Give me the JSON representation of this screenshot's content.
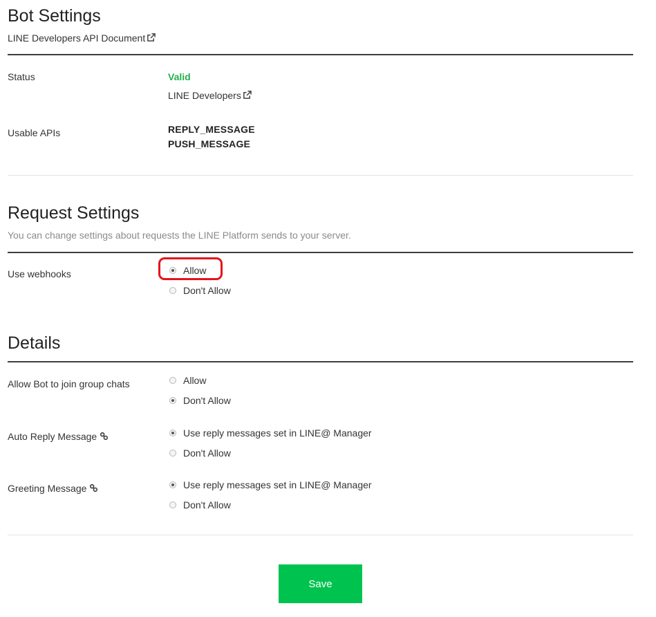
{
  "bot_settings": {
    "title": "Bot Settings",
    "doc_link": "LINE Developers API Document",
    "status_label": "Status",
    "status_value": "Valid",
    "status_link": "LINE Developers",
    "usable_apis_label": "Usable APIs",
    "usable_apis": [
      "REPLY_MESSAGE",
      "PUSH_MESSAGE"
    ]
  },
  "request_settings": {
    "title": "Request Settings",
    "description": "You can change settings about requests the LINE Platform sends to your server.",
    "webhooks_label": "Use webhooks",
    "webhooks_options": [
      "Allow",
      "Don't Allow"
    ],
    "webhooks_selected": "Allow"
  },
  "details": {
    "title": "Details",
    "group_chats_label": "Allow Bot to join group chats",
    "group_chats_options": [
      "Allow",
      "Don't Allow"
    ],
    "group_chats_selected": "Don't Allow",
    "auto_reply_label": "Auto Reply Message",
    "auto_reply_options": [
      "Use reply messages set in LINE@ Manager",
      "Don't Allow"
    ],
    "auto_reply_selected": "Use reply messages set in LINE@ Manager",
    "greeting_label": "Greeting Message",
    "greeting_options": [
      "Use reply messages set in LINE@ Manager",
      "Don't Allow"
    ],
    "greeting_selected": "Use reply messages set in LINE@ Manager"
  },
  "actions": {
    "save_label": "Save"
  },
  "colors": {
    "accent": "#00c34f",
    "valid": "#22b14c",
    "highlight": "#e3141b"
  }
}
